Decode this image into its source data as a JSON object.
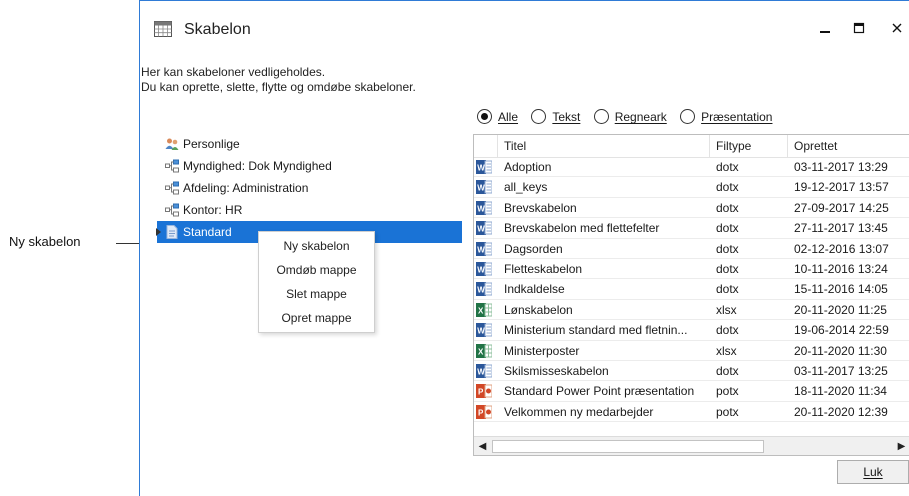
{
  "callout": {
    "label": "Ny skabelon"
  },
  "window": {
    "title": "Skabelon",
    "icon": "calendar-grid-icon",
    "minimize": "_",
    "maximize": "□",
    "close": "✕"
  },
  "description": {
    "line1": "Her kan skabeloner vedligeholdes.",
    "line2": "Du kan oprette, slette, flytte og omdøbe skabeloner."
  },
  "tree": {
    "items": [
      {
        "label": "Personlige",
        "icon": "people-icon"
      },
      {
        "label": "Myndighed: Dok Myndighed",
        "icon": "org-chart-icon"
      },
      {
        "label": "Afdeling: Administration",
        "icon": "org-chart-icon"
      },
      {
        "label": "Kontor: HR",
        "icon": "org-chart-icon"
      },
      {
        "label": "Standard",
        "icon": "document-icon",
        "selected": true
      }
    ]
  },
  "context_menu": {
    "items": [
      "Ny skabelon",
      "Omdøb mappe",
      "Slet mappe",
      "Opret mappe"
    ]
  },
  "filter": {
    "options": [
      "Alle",
      "Tekst",
      "Regneark",
      "Præsentation"
    ],
    "selected": "Alle"
  },
  "table": {
    "columns": [
      "Titel",
      "Filtype",
      "Oprettet"
    ],
    "rows": [
      {
        "title": "Adoption",
        "type": "dotx",
        "created": "03-11-2017 13:29",
        "icon": "word-icon"
      },
      {
        "title": "all_keys",
        "type": "dotx",
        "created": "19-12-2017 13:57",
        "icon": "word-icon"
      },
      {
        "title": "Brevskabelon",
        "type": "dotx",
        "created": "27-09-2017 14:25",
        "icon": "word-icon"
      },
      {
        "title": "Brevskabelon med flettefelter",
        "type": "dotx",
        "created": "27-11-2017 13:45",
        "icon": "word-icon"
      },
      {
        "title": "Dagsorden",
        "type": "dotx",
        "created": "02-12-2016 13:07",
        "icon": "word-icon"
      },
      {
        "title": "Fletteskabelon",
        "type": "dotx",
        "created": "10-11-2016 13:24",
        "icon": "word-icon"
      },
      {
        "title": "Indkaldelse",
        "type": "dotx",
        "created": "15-11-2016 14:05",
        "icon": "word-icon"
      },
      {
        "title": "Lønskabelon",
        "type": "xlsx",
        "created": "20-11-2020 11:25",
        "icon": "excel-icon"
      },
      {
        "title": "Ministerium standard med fletnin...",
        "type": "dotx",
        "created": "19-06-2014 22:59",
        "icon": "word-icon"
      },
      {
        "title": "Ministerposter",
        "type": "xlsx",
        "created": "20-11-2020 11:30",
        "icon": "excel-icon"
      },
      {
        "title": "Skilsmisseskabelon",
        "type": "dotx",
        "created": "03-11-2017 13:25",
        "icon": "word-icon"
      },
      {
        "title": "Standard Power Point præsentation",
        "type": "potx",
        "created": "18-11-2020 11:34",
        "icon": "powerpoint-icon"
      },
      {
        "title": "Velkommen ny medarbejder",
        "type": "potx",
        "created": "20-11-2020 12:39",
        "icon": "powerpoint-icon"
      }
    ]
  },
  "buttons": {
    "close": "Luk"
  },
  "colors": {
    "selection": "#1a73d6",
    "word": "#2b579a",
    "excel": "#217346",
    "powerpoint": "#d24726"
  }
}
